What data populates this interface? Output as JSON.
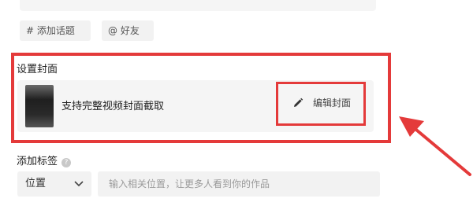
{
  "tags": {
    "topic_chip": "# 添加话题",
    "friend_chip": "@ 好友"
  },
  "cover": {
    "section_title": "设置封面",
    "description": "支持完整视频封面截取",
    "edit_label": "编辑封面"
  },
  "label_section": {
    "title": "添加标签",
    "help": "?",
    "location_select": "位置",
    "location_placeholder": "输入相关位置，让更多人看到你的作品"
  },
  "annotation": {
    "highlight_color": "#e43a3a"
  }
}
